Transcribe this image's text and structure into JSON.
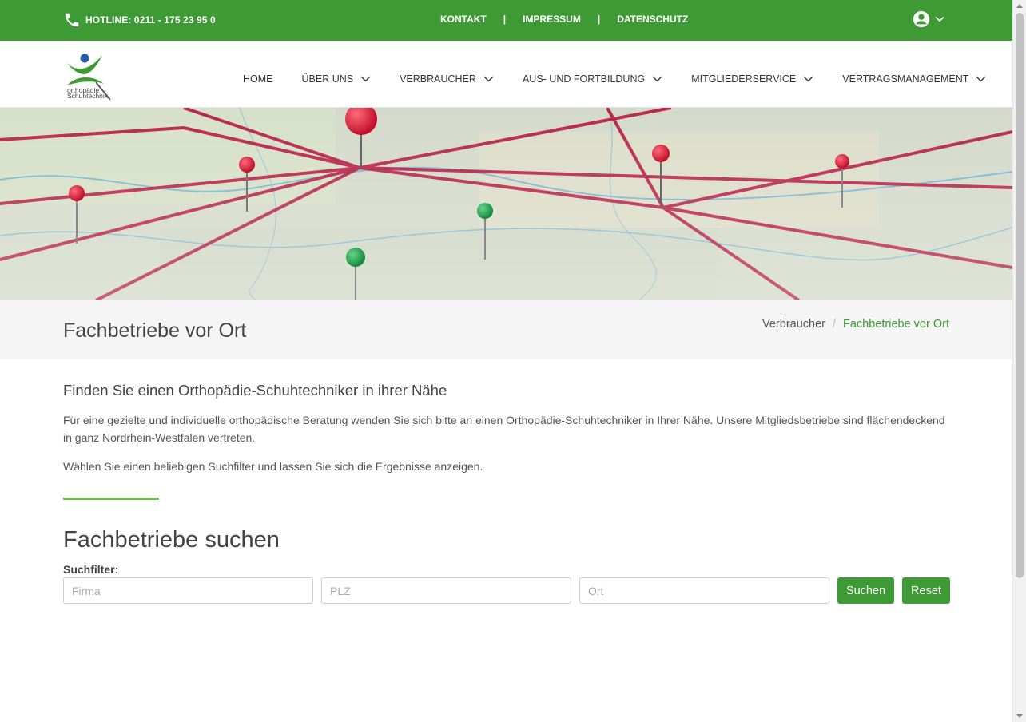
{
  "topbar": {
    "hotline": "HOTLINE: 0211 - 175 23 95 0",
    "links": [
      "KONTAKT",
      "IMPRESSUM",
      "DATENSCHUTZ"
    ],
    "separator": "|"
  },
  "nav": {
    "logo_text_1": "orthopädie",
    "logo_text_2": "Schuhtechnik",
    "items": [
      {
        "label": "HOME",
        "has_dropdown": false
      },
      {
        "label": "ÜBER UNS",
        "has_dropdown": true
      },
      {
        "label": "VERBRAUCHER",
        "has_dropdown": true
      },
      {
        "label": "AUS- UND FORTBILDUNG",
        "has_dropdown": true
      },
      {
        "label": "MITGLIEDERSERVICE",
        "has_dropdown": true
      },
      {
        "label": "VERTRAGSMANAGEMENT",
        "has_dropdown": true
      }
    ]
  },
  "page": {
    "title": "Fachbetriebe vor Ort",
    "breadcrumb": [
      "Verbraucher",
      "Fachbetriebe vor Ort"
    ],
    "breadcrumb_sep": "/"
  },
  "content": {
    "subhead": "Finden Sie einen Orthopädie-Schuhtechniker in ihrer Nähe",
    "para1": "Für eine gezielte und individuelle orthopädische Beratung wenden Sie sich bitte an einen Orthopädie-Schuhtechniker in Ihrer Nähe. Unsere Mitgliedsbetriebe sind flächendeckend in ganz Nordrhein-Westfalen vertreten.",
    "para2": "Wählen Sie einen beliebigen Suchfilter und lassen Sie sich die Ergebnisse anzeigen.",
    "search_title": "Fachbetriebe suchen",
    "filter_label": "Suchfilter:",
    "inputs": {
      "firma_placeholder": "Firma",
      "plz_placeholder": "PLZ",
      "ort_placeholder": "Ort"
    },
    "search_button": "Suchen",
    "reset_button": "Reset"
  },
  "colors": {
    "brand_green": "#3e9a35",
    "accent_green": "#6cc04a",
    "logo_blue": "#1f5fa8"
  },
  "icons": [
    "phone-icon",
    "user-circle-icon",
    "chevron-down-icon"
  ]
}
